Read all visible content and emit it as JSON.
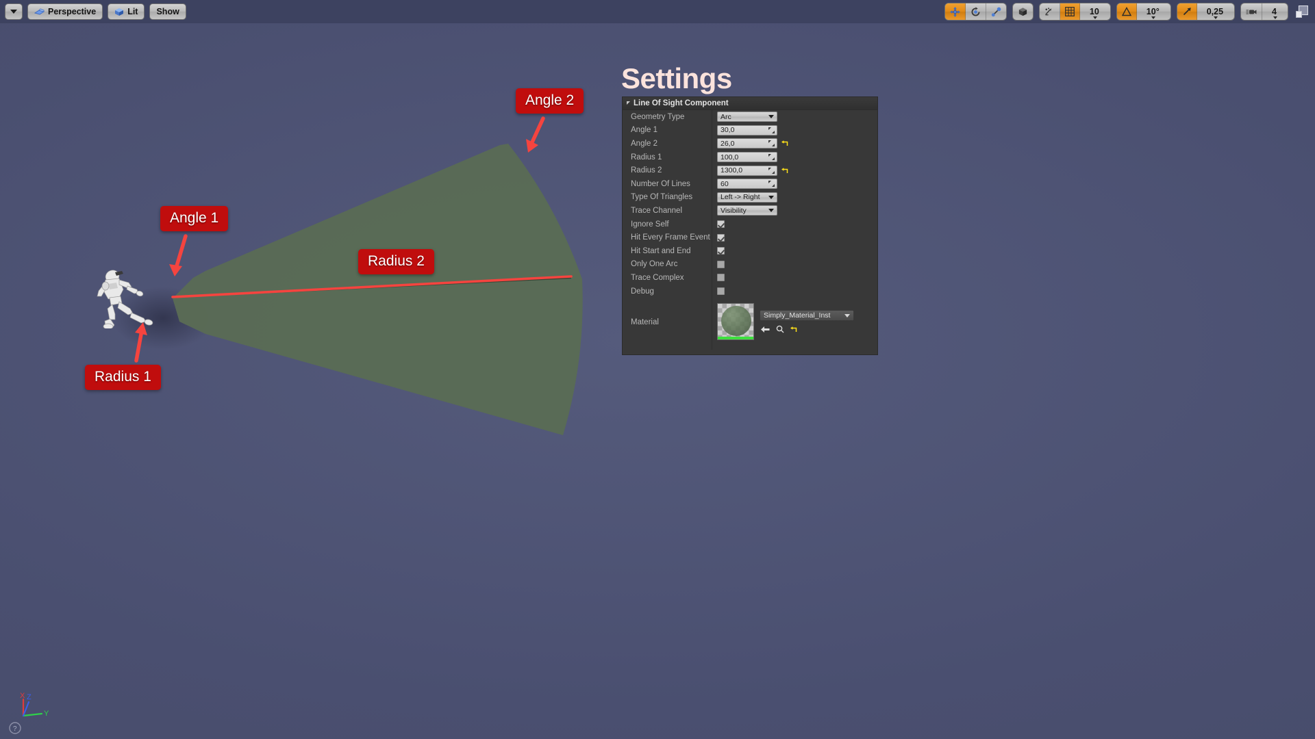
{
  "toolbar": {
    "dropdown_caret": "viewport-options",
    "perspective_label": "Perspective",
    "lit_label": "Lit",
    "show_label": "Show",
    "transform_tools": [
      "move-tool",
      "rotate-tool",
      "scale-tool"
    ],
    "coordinate_system": "world-space",
    "surface_snap": "surface-snapping",
    "grid_snap_enabled": true,
    "grid_snap_value": "10",
    "angle_snap_enabled": true,
    "angle_snap_value": "10°",
    "scale_snap_enabled": true,
    "scale_snap_value": "0,25",
    "camera_speed_value": "4",
    "maximize_label": "maximize-viewport"
  },
  "annotations": [
    {
      "id": "angle1",
      "label": "Angle 1"
    },
    {
      "id": "angle2",
      "label": "Angle 2"
    },
    {
      "id": "radius1",
      "label": "Radius 1"
    },
    {
      "id": "radius2",
      "label": "Radius 2"
    }
  ],
  "settings": {
    "title": "Settings",
    "category": "Line Of Sight Component",
    "rows": [
      {
        "label": "Geometry Type",
        "type": "combo",
        "value": "Arc",
        "reset": false
      },
      {
        "label": "Angle 1",
        "type": "number",
        "value": "30,0",
        "reset": false
      },
      {
        "label": "Angle 2",
        "type": "number",
        "value": "26,0",
        "reset": true
      },
      {
        "label": "Radius 1",
        "type": "number",
        "value": "100,0",
        "reset": false
      },
      {
        "label": "Radius 2",
        "type": "number",
        "value": "1300,0",
        "reset": true
      },
      {
        "label": "Number Of Lines",
        "type": "number",
        "value": "60",
        "reset": false
      },
      {
        "label": "Type Of Triangles",
        "type": "combo",
        "value": "Left -> Right",
        "reset": false
      },
      {
        "label": "Trace Channel",
        "type": "combo",
        "value": "Visibility",
        "reset": false
      },
      {
        "label": "Ignore Self",
        "type": "checkbox",
        "value": true,
        "reset": false
      },
      {
        "label": "Hit Every Frame Event",
        "type": "checkbox",
        "value": true,
        "reset": false
      },
      {
        "label": "Hit Start and End",
        "type": "checkbox",
        "value": true,
        "reset": false
      },
      {
        "label": "Only One Arc",
        "type": "checkbox",
        "value": false,
        "reset": false
      },
      {
        "label": "Trace Complex",
        "type": "checkbox",
        "value": false,
        "reset": false
      },
      {
        "label": "Debug",
        "type": "checkbox",
        "value": false,
        "reset": false
      }
    ],
    "material": {
      "label": "Material",
      "asset_name": "Simply_Material_Inst",
      "buttons": [
        "use-selected-asset-icon",
        "browse-to-asset-icon",
        "reset-to-default-icon"
      ]
    }
  },
  "gizmo": {
    "axis_x": "X",
    "axis_y": "Y",
    "axis_z": "Z",
    "help": "?"
  },
  "colors": {
    "viewport_bg": "#4b5070",
    "cone_fill": "#5a6b55",
    "annotation_bg": "#c00d0d",
    "accent_orange": "#e08a18",
    "reset_yellow": "#ffe11a",
    "title_color": "#fbe3dc"
  }
}
